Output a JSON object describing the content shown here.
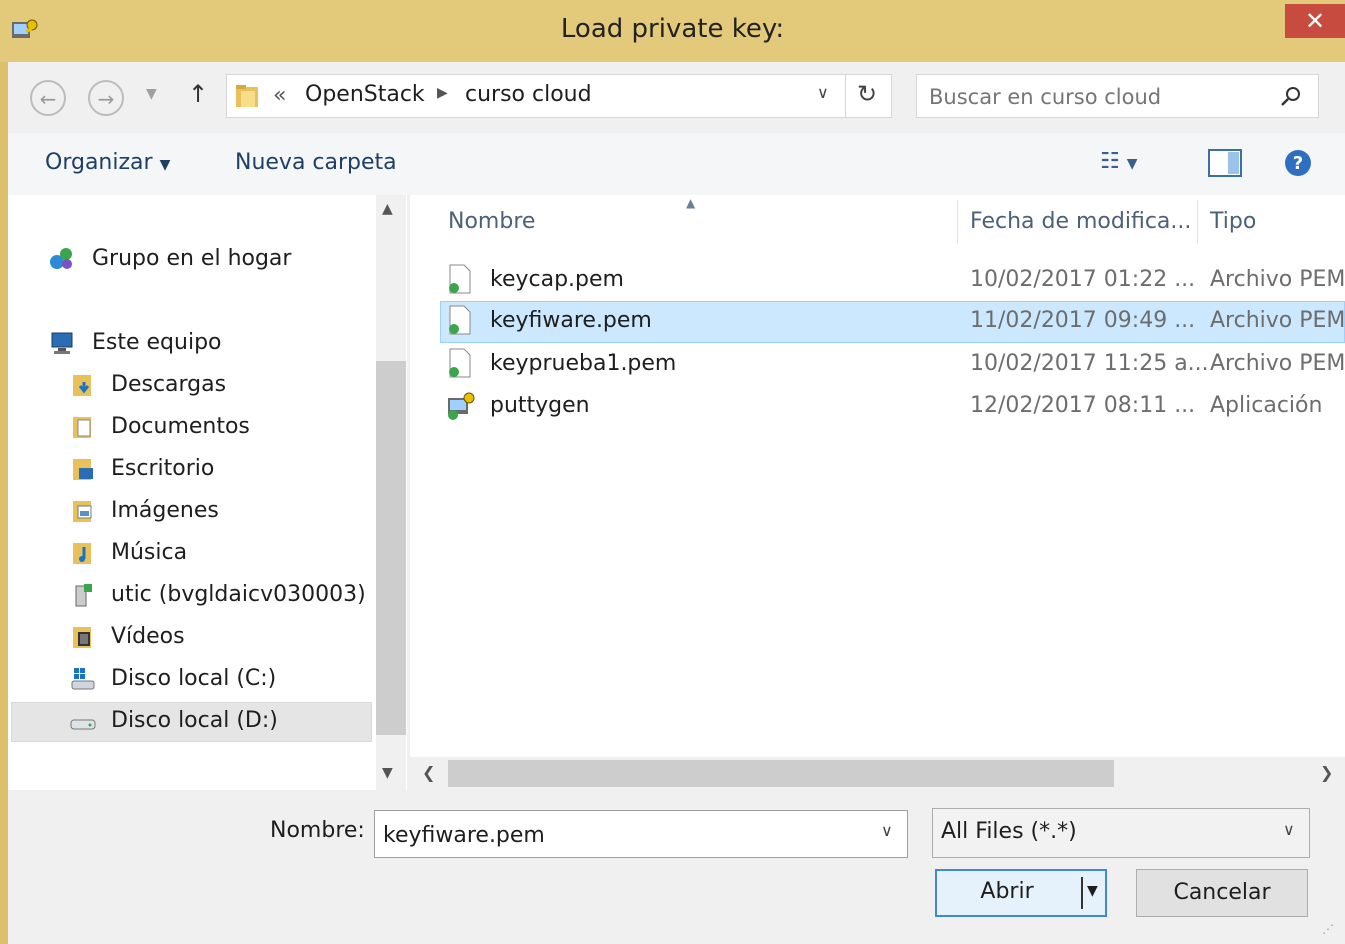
{
  "window": {
    "title": "Load private key:",
    "close_glyph": "✕"
  },
  "address": {
    "chevrons": "«",
    "crumbs": [
      "OpenStack",
      "curso cloud"
    ],
    "search_placeholder": "Buscar en curso cloud"
  },
  "toolbar": {
    "organize": "Organizar",
    "new_folder": "Nueva carpeta"
  },
  "nav": {
    "homegroup": "Grupo en el hogar",
    "thispc": "Este equipo",
    "items": [
      "Descargas",
      "Documentos",
      "Escritorio",
      "Imágenes",
      "Música",
      "utic (bvgldaicv030003)",
      "Vídeos",
      "Disco local (C:)",
      "Disco local (D:)"
    ]
  },
  "columns": {
    "name": "Nombre",
    "date": "Fecha de modifica...",
    "type": "Tipo"
  },
  "files": [
    {
      "name": "keycap.pem",
      "date": "10/02/2017 01:22 ...",
      "type": "Archivo PEM",
      "icon": "pem-file-icon"
    },
    {
      "name": "keyfiware.pem",
      "date": "11/02/2017 09:49 ...",
      "type": "Archivo PEM",
      "icon": "pem-file-icon",
      "selected": true
    },
    {
      "name": "keyprueba1.pem",
      "date": "10/02/2017 11:25 a...",
      "type": "Archivo PEM",
      "icon": "pem-file-icon"
    },
    {
      "name": "puttygen",
      "date": "12/02/2017 08:11 ...",
      "type": "Aplicación",
      "icon": "puttygen-app-icon"
    }
  ],
  "bottom": {
    "name_label": "Nombre:",
    "name_value": "keyfiware.pem",
    "filter_value": "All Files (*.*)",
    "open_label": "Abrir",
    "cancel_label": "Cancelar"
  },
  "colors": {
    "title_bar": "#e3c97a",
    "close": "#c74b3e",
    "selection": "#cce8ff",
    "accent_blue": "#1a73c7"
  }
}
